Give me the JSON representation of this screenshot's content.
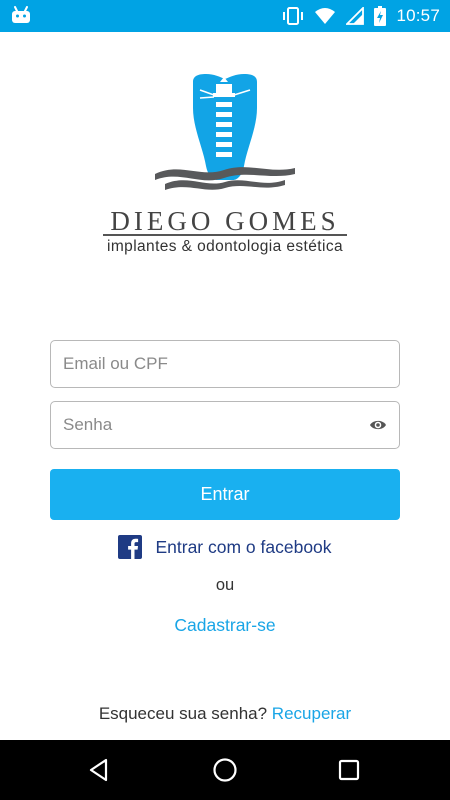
{
  "status_bar": {
    "time": "10:57",
    "icons": [
      "android-icon",
      "vibrate-icon",
      "wifi-icon",
      "signal-icon",
      "battery-charging-icon"
    ],
    "background_color": "#00a3e4"
  },
  "brand": {
    "name": "DIEGO GOMES",
    "tagline": "implantes & odontologia estética",
    "logo_colors": {
      "tooth": "#12a4e6",
      "waves": "#58595b"
    }
  },
  "login": {
    "email_placeholder": "Email ou CPF",
    "password_placeholder": "Senha",
    "show_password_icon": "eye-icon",
    "submit_label": "Entrar",
    "submit_color": "#19b0f0",
    "facebook_label": "Entrar com o facebook",
    "facebook_icon": "facebook-icon",
    "or_label": "ou",
    "register_label": "Cadastrar-se",
    "forgot_text": "Esqueceu sua senha?",
    "recover_label": "Recuperar"
  },
  "nav_bar": {
    "buttons": [
      "back-icon",
      "home-icon",
      "recents-icon"
    ]
  }
}
